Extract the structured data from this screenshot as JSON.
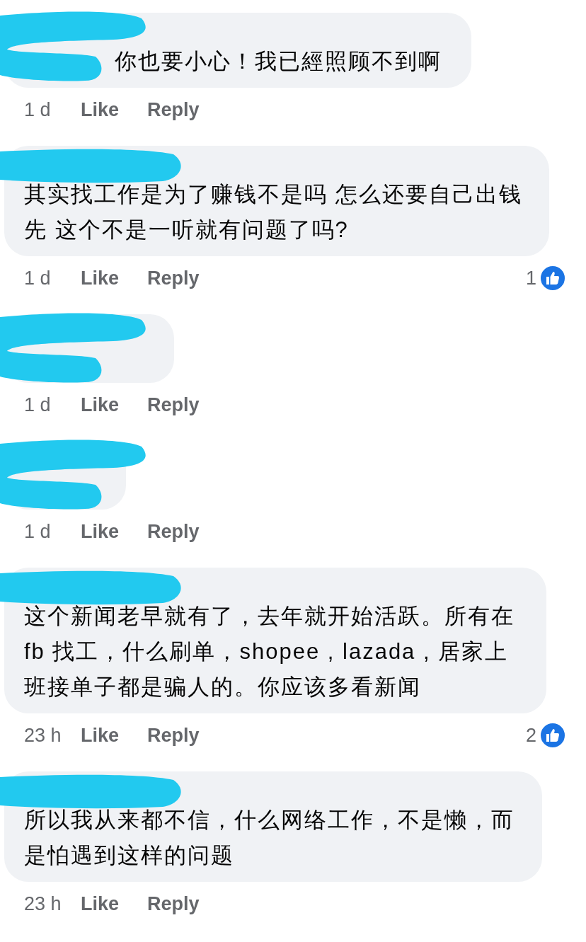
{
  "comments": [
    {
      "text": "你也要小心！我已經照顾不到啊",
      "time": "1 d",
      "like": "Like",
      "reply": "Reply"
    },
    {
      "text": "其实找工作是为了赚钱不是吗 怎么还要自己出钱先 这个不是一听就有问题了吗?",
      "time": "1 d",
      "like": "Like",
      "reply": "Reply",
      "reactions": "1"
    },
    {
      "time": "1 d",
      "like": "Like",
      "reply": "Reply"
    },
    {
      "time": "1 d",
      "like": "Like",
      "reply": "Reply"
    },
    {
      "text": "这个新闻老早就有了，去年就开始活跃。所有在 fb 找工，什么刷单，shopee , lazada , 居家上班接单子都是骗人的。你应该多看新闻",
      "time": "23 h",
      "like": "Like",
      "reply": "Reply",
      "reactions": "2"
    },
    {
      "text": "所以我从来都不信，什么网络工作，不是懒，而是怕遇到这样的问题",
      "time": "23 h",
      "like": "Like",
      "reply": "Reply"
    }
  ]
}
